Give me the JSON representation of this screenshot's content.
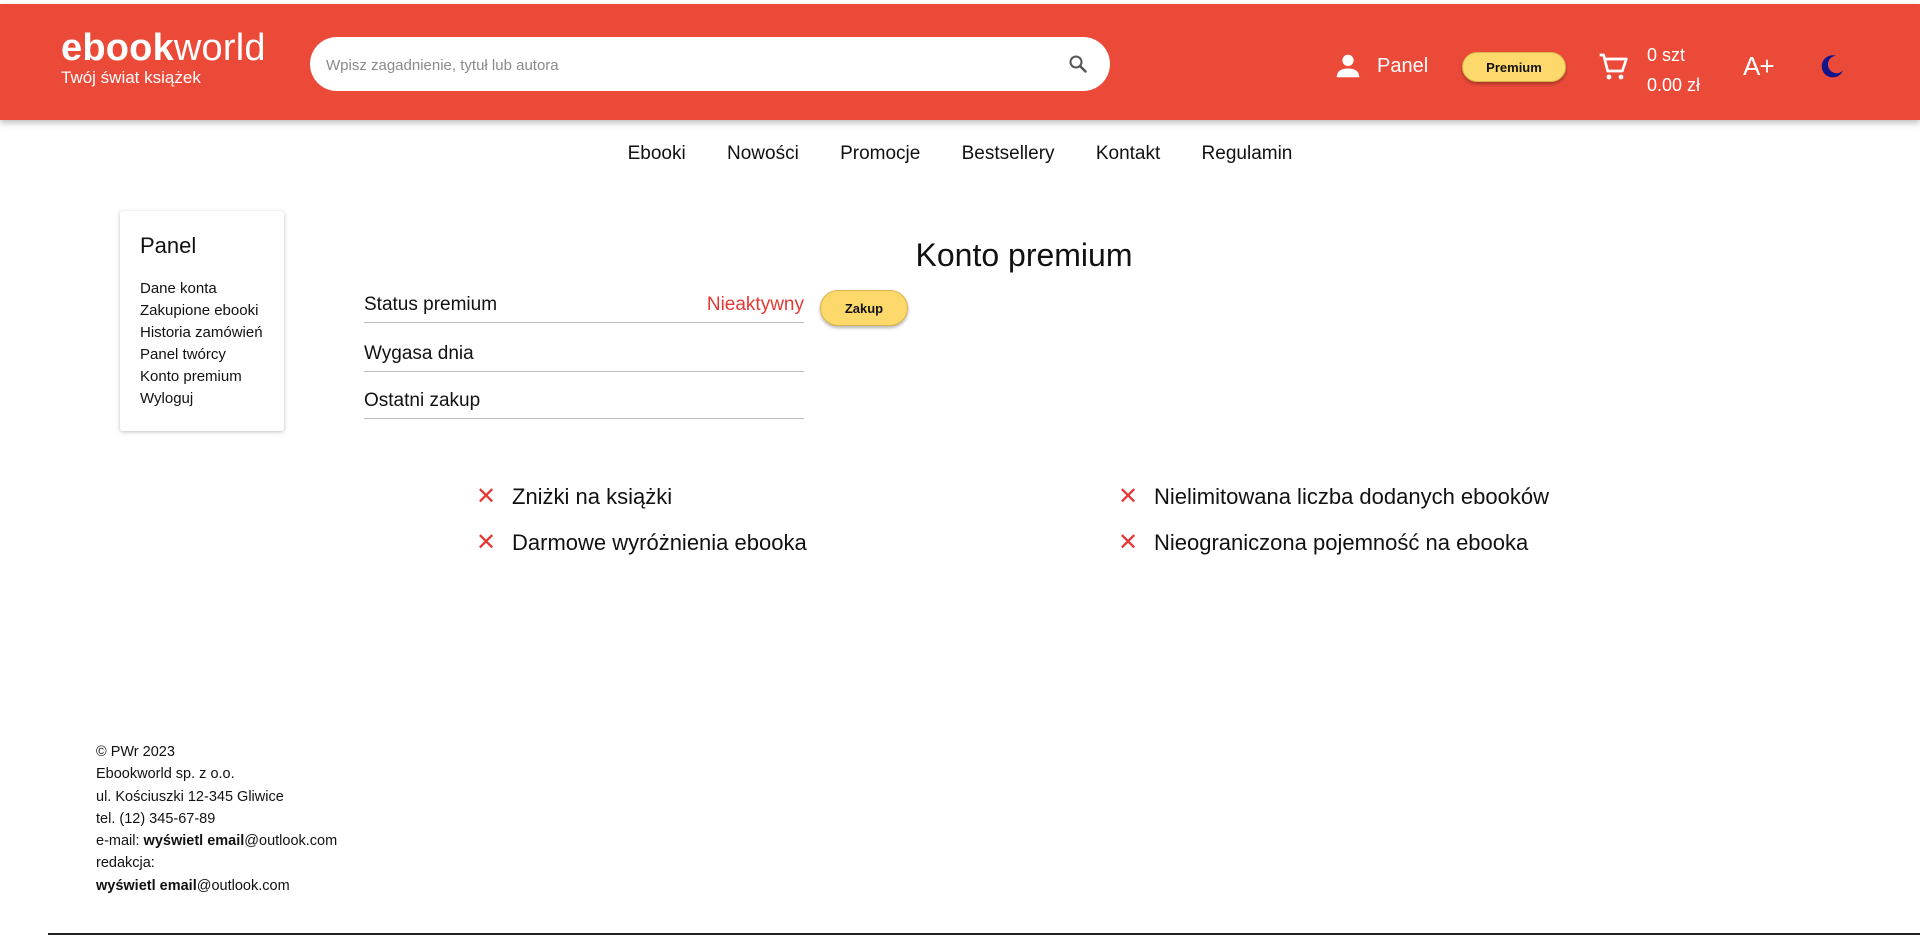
{
  "brand": {
    "logo_bold": "ebook",
    "logo_light": "world",
    "tagline": "Twój świat książek",
    "accent_color": "#ec4a39",
    "button_color": "#fdd96b"
  },
  "search": {
    "placeholder": "Wpisz zagadnienie, tytuł lub autora",
    "value": "",
    "icon": "search-icon"
  },
  "header": {
    "panel_label": "Panel",
    "premium_label": "Premium",
    "cart_count": "0 szt",
    "cart_total": "0.00 zł",
    "font_size_label": "A+",
    "theme_icon": "moon-icon"
  },
  "nav": {
    "items": [
      "Ebooki",
      "Nowości",
      "Promocje",
      "Bestsellery",
      "Kontakt",
      "Regulamin"
    ]
  },
  "sidebar": {
    "title": "Panel",
    "items": [
      "Dane konta",
      "Zakupione ebooki",
      "Historia zamówień",
      "Panel twórcy",
      "Konto premium",
      "Wyloguj"
    ]
  },
  "main": {
    "title": "Konto premium",
    "rows": [
      {
        "label": "Status premium",
        "value": "Nieaktywny"
      },
      {
        "label": "Wygasa dnia",
        "value": ""
      },
      {
        "label": "Ostatni zakup",
        "value": ""
      }
    ],
    "buy_label": "Zakup",
    "features": [
      {
        "icon": "close-icon",
        "mark": "✕",
        "text": "Zniżki na książki"
      },
      {
        "icon": "close-icon",
        "mark": "✕",
        "text": "Darmowe wyróżnienia ebooka"
      },
      {
        "icon": "close-icon",
        "mark": "✕",
        "text": "Nielimitowana liczba dodanych ebooków"
      },
      {
        "icon": "close-icon",
        "mark": "✕",
        "text": "Nieograniczona pojemność na ebooka"
      }
    ]
  },
  "footer": {
    "copyright": "© PWr 2023",
    "company": "Ebookworld sp. z o.o.",
    "address": "ul. Kościuszki 12-345 Gliwice",
    "phone": "tel. (12) 345-67-89",
    "email_prefix": "e-mail: ",
    "email_reveal": "wyświetl email",
    "email_domain": "@outlook.com",
    "editorial_label": "redakcja:",
    "editorial_reveal": "wyświetl email",
    "editorial_domain": "@outlook.com"
  }
}
